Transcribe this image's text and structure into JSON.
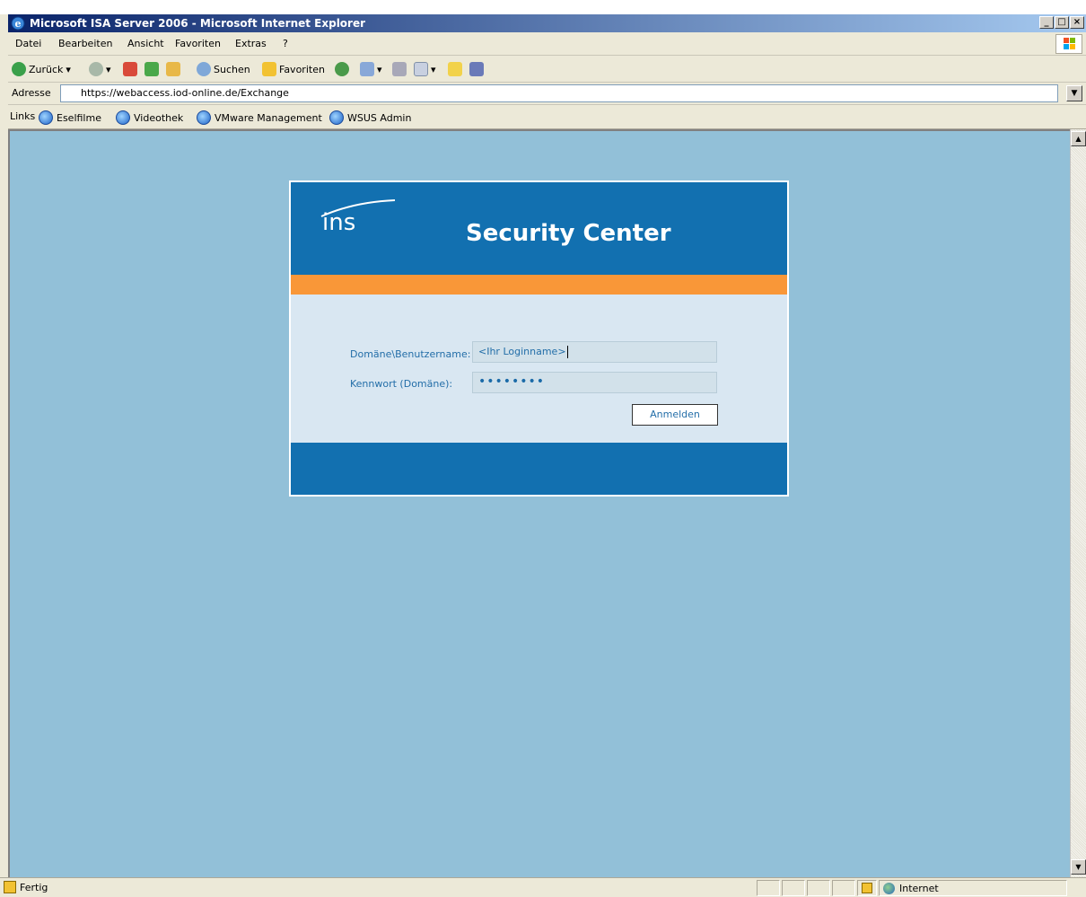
{
  "window": {
    "title": "Microsoft ISA Server 2006 - Microsoft Internet Explorer"
  },
  "menu": {
    "items": [
      "Datei",
      "Bearbeiten",
      "Ansicht",
      "Favoriten",
      "Extras",
      "?"
    ]
  },
  "toolbar": {
    "back_label": "Zurück",
    "search_label": "Suchen",
    "favorites_label": "Favoriten"
  },
  "address": {
    "label": "Adresse",
    "url": "https://webaccess.iod-online.de/Exchange"
  },
  "links": {
    "label": "Links",
    "items": [
      "Eselfilme",
      "Videothek",
      "VMware Management",
      "WSUS Admin"
    ]
  },
  "login": {
    "logo_text": "ins",
    "heading": "Security Center",
    "username_label": "Domäne\\Benutzername:",
    "username_value": "<Ihr Loginname>",
    "password_label": "Kennwort (Domäne):",
    "password_value": "••••••••",
    "submit_label": "Anmelden"
  },
  "status": {
    "text": "Fertig",
    "zone": "Internet"
  },
  "colors": {
    "header_blue": "#1270b0",
    "orange_band": "#f99738",
    "page_background": "#92c0d8",
    "form_background": "#d9e7f2"
  }
}
